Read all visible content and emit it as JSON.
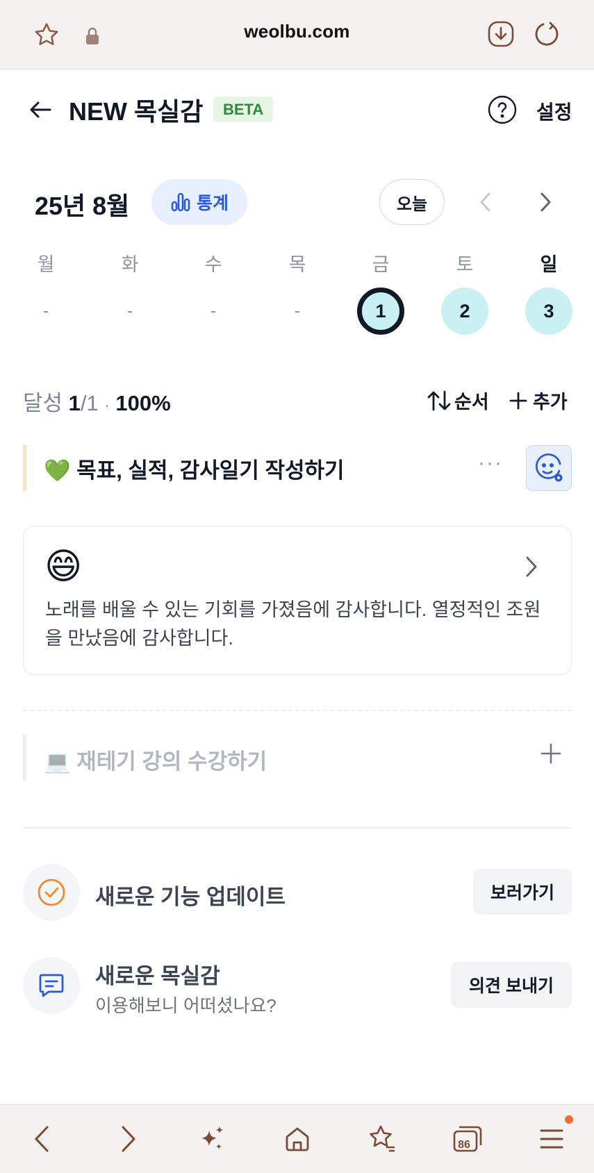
{
  "browser": {
    "url": "weolbu.com",
    "tab_count": "86"
  },
  "header": {
    "title": "NEW 목실감",
    "badge": "BETA",
    "settings_label": "설정"
  },
  "calendar": {
    "month_label": "25년 8월",
    "stats_label": "통계",
    "today_label": "오늘",
    "weekdays": [
      "월",
      "화",
      "수",
      "목",
      "금",
      "토",
      "일"
    ],
    "days": [
      "-",
      "-",
      "-",
      "-",
      "1",
      "2",
      "3"
    ],
    "selected_day": "1"
  },
  "summary": {
    "label": "달성",
    "done": "1",
    "total": "/1",
    "sep": "·",
    "percent": "100%",
    "order_label": "순서",
    "add_label": "추가"
  },
  "goals": [
    {
      "emoji": "💚",
      "text": "목표, 실적, 감사일기 작성하기",
      "more": "···"
    },
    {
      "emoji": "💻",
      "text": "재테기 강의 수강하기"
    }
  ],
  "entry_card": {
    "emoji": "😄",
    "text": "노래를 배울 수 있는 기회를 가졌음에 감사합니다. 열정적인 조원을 만났음에 감사합니다."
  },
  "updates": [
    {
      "title": "새로운 기능 업데이트",
      "button": "보러가기"
    },
    {
      "title": "새로운 목실감",
      "subtitle": "이용해보니 어떠셨나요?",
      "button": "의견 보내기"
    }
  ],
  "colors": {
    "accent_blue": "#2a5bd7",
    "day_fill": "#c9f1f4",
    "browser_icon": "#7a4a33"
  }
}
